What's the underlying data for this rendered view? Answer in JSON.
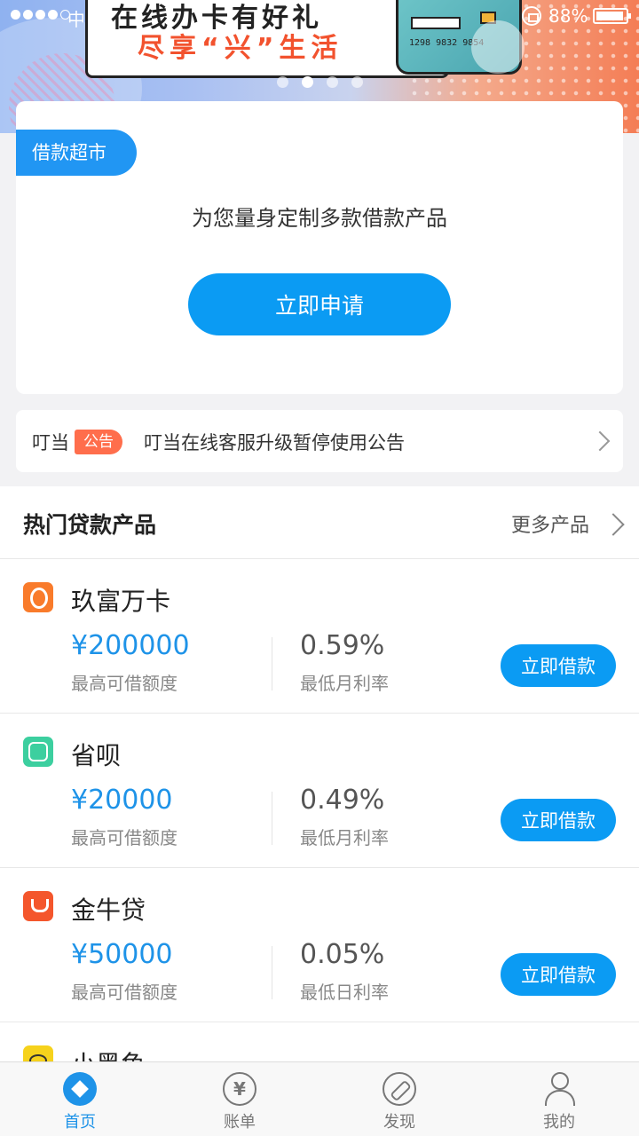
{
  "status_bar": {
    "carrier": "中",
    "battery": "88%"
  },
  "banner": {
    "headline": "在线办卡有好礼",
    "slogan": "尽享“兴”生活",
    "card_number": "1298 9832 9854",
    "slides": 4,
    "active_slide": 2
  },
  "market": {
    "tag": "借款超市",
    "description": "为您量身定制多款借款产品",
    "apply_label": "立即申请"
  },
  "notice": {
    "brand": "叮当",
    "badge": "公告",
    "text": "叮当在线客服升级暂停使用公告"
  },
  "products": {
    "title": "热门贷款产品",
    "more_label": "更多产品",
    "items": [
      {
        "name": "玖富万卡",
        "logo": "jiufu-logo",
        "amount": "¥200000",
        "amount_label": "最高可借额度",
        "rate": "0.59%",
        "rate_label": "最低月利率",
        "button": "立即借款"
      },
      {
        "name": "省呗",
        "logo": "shengbei-logo",
        "amount": "¥20000",
        "amount_label": "最高可借额度",
        "rate": "0.49%",
        "rate_label": "最低月利率",
        "button": "立即借款"
      },
      {
        "name": "金牛贷",
        "logo": "jinniu-logo",
        "amount": "¥50000",
        "amount_label": "最高可借额度",
        "rate": "0.05%",
        "rate_label": "最低日利率",
        "button": "立即借款"
      },
      {
        "name": "小黑鱼",
        "logo": "xiaoheiyu-logo"
      }
    ]
  },
  "tabbar": {
    "tabs": [
      {
        "label": "首页",
        "icon": "home-icon",
        "active": true
      },
      {
        "label": "账单",
        "icon": "bill-icon",
        "active": false
      },
      {
        "label": "发现",
        "icon": "discover-icon",
        "active": false
      },
      {
        "label": "我的",
        "icon": "profile-icon",
        "active": false
      }
    ]
  },
  "colors": {
    "primary": "#0b9bf3",
    "accent": "#ff6e4c",
    "amount": "#1e93e8"
  }
}
